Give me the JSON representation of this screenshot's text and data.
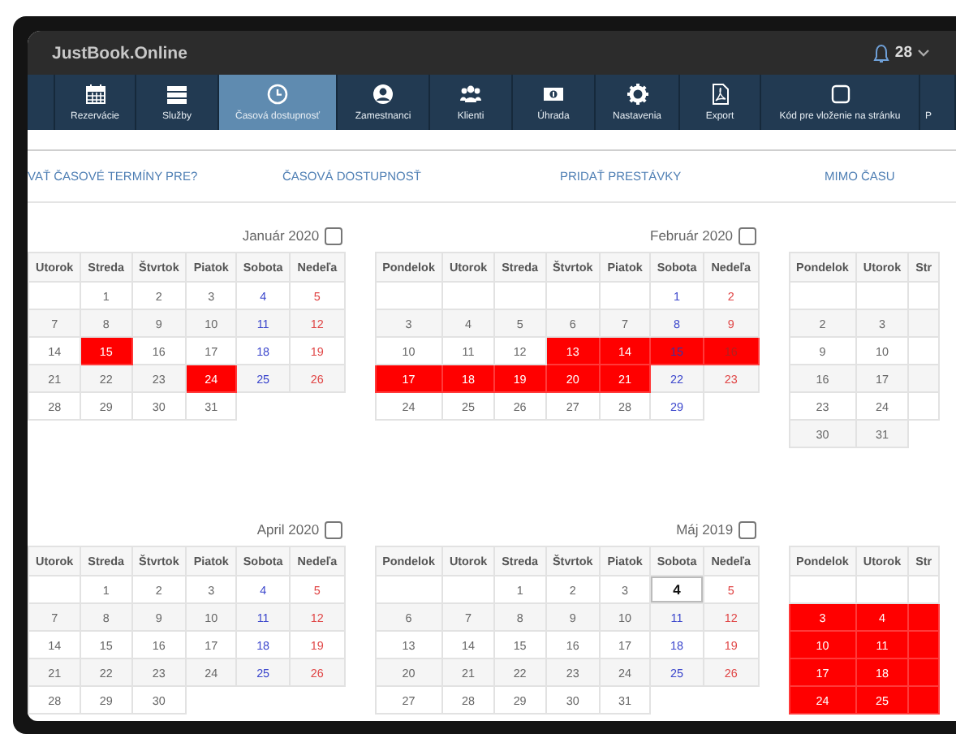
{
  "header": {
    "brand": "JustBook.Online",
    "notifications": "28"
  },
  "nav": [
    {
      "label": "Rezervácie",
      "selected": false
    },
    {
      "label": "Služby",
      "selected": false
    },
    {
      "label": "Časová dostupnosť",
      "selected": true
    },
    {
      "label": "Zamestnanci",
      "selected": false
    },
    {
      "label": "Klienti",
      "selected": false
    },
    {
      "label": "Úhrada",
      "selected": false
    },
    {
      "label": "Nastavenia",
      "selected": false
    },
    {
      "label": "Export",
      "selected": false
    },
    {
      "label": "Kód pre vloženie na stránku",
      "selected": false
    },
    {
      "label": "P",
      "selected": false
    }
  ],
  "subtabs": [
    "VAŤ ČASOVÉ TERMÍNY PRE?",
    "ČASOVÁ DOSTUPNOSŤ",
    "PRIDAŤ PRESTÁVKY",
    "MIMO ČASU"
  ],
  "calendar_rows": [
    {
      "calendars": [
        {
          "title": "Január 2020",
          "checked": false,
          "columns": [
            {
              "label": "Utorok",
              "kind": "weekday"
            },
            {
              "label": "Streda",
              "kind": "weekday"
            },
            {
              "label": "Štvrtok",
              "kind": "weekday"
            },
            {
              "label": "Piatok",
              "kind": "weekday"
            },
            {
              "label": "Sobota",
              "kind": "saturday"
            },
            {
              "label": "Nedeľa",
              "kind": "sunday"
            }
          ],
          "weeks": [
            [
              {
                "blocked": false,
                "today": false
              },
              {
                "day": "1",
                "blocked": false,
                "today": false
              },
              {
                "day": "2",
                "blocked": false,
                "today": false
              },
              {
                "day": "3",
                "blocked": false,
                "today": false
              },
              {
                "day": "4",
                "blocked": false,
                "today": false
              },
              {
                "day": "5",
                "blocked": false,
                "today": false
              }
            ],
            [
              {
                "day": "7",
                "blocked": false,
                "today": false
              },
              {
                "day": "8",
                "blocked": false,
                "today": false
              },
              {
                "day": "9",
                "blocked": false,
                "today": false
              },
              {
                "day": "10",
                "blocked": false,
                "today": false
              },
              {
                "day": "11",
                "blocked": false,
                "today": false
              },
              {
                "day": "12",
                "blocked": false,
                "today": false
              }
            ],
            [
              {
                "day": "14",
                "blocked": false,
                "today": false
              },
              {
                "day": "15",
                "blocked": true,
                "today": false
              },
              {
                "day": "16",
                "blocked": false,
                "today": false
              },
              {
                "day": "17",
                "blocked": false,
                "today": false
              },
              {
                "day": "18",
                "blocked": false,
                "today": false
              },
              {
                "day": "19",
                "blocked": false,
                "today": false
              }
            ],
            [
              {
                "day": "21",
                "blocked": false,
                "today": false
              },
              {
                "day": "22",
                "blocked": false,
                "today": false
              },
              {
                "day": "23",
                "blocked": false,
                "today": false
              },
              {
                "day": "24",
                "blocked": true,
                "today": false
              },
              {
                "day": "25",
                "blocked": false,
                "today": false
              },
              {
                "day": "26",
                "blocked": false,
                "today": false
              }
            ],
            [
              {
                "day": "28",
                "blocked": false,
                "today": false
              },
              {
                "day": "29",
                "blocked": false,
                "today": false
              },
              {
                "day": "30",
                "blocked": false,
                "today": false
              },
              {
                "day": "31",
                "blocked": false,
                "today": false
              }
            ]
          ]
        },
        {
          "title": "Február 2020",
          "checked": false,
          "columns": [
            {
              "label": "Pondelok",
              "kind": "weekday"
            },
            {
              "label": "Utorok",
              "kind": "weekday"
            },
            {
              "label": "Streda",
              "kind": "weekday"
            },
            {
              "label": "Štvrtok",
              "kind": "weekday"
            },
            {
              "label": "Piatok",
              "kind": "weekday"
            },
            {
              "label": "Sobota",
              "kind": "saturday"
            },
            {
              "label": "Nedeľa",
              "kind": "sunday"
            }
          ],
          "weeks": [
            [
              {
                "blocked": false,
                "today": false
              },
              {
                "blocked": false,
                "today": false
              },
              {
                "blocked": false,
                "today": false
              },
              {
                "blocked": false,
                "today": false
              },
              {
                "blocked": false,
                "today": false
              },
              {
                "day": "1",
                "blocked": false,
                "today": false
              },
              {
                "day": "2",
                "blocked": false,
                "today": false
              }
            ],
            [
              {
                "day": "3",
                "blocked": false,
                "today": false
              },
              {
                "day": "4",
                "blocked": false,
                "today": false
              },
              {
                "day": "5",
                "blocked": false,
                "today": false
              },
              {
                "day": "6",
                "blocked": false,
                "today": false
              },
              {
                "day": "7",
                "blocked": false,
                "today": false
              },
              {
                "day": "8",
                "blocked": false,
                "today": false
              },
              {
                "day": "9",
                "blocked": false,
                "today": false
              }
            ],
            [
              {
                "day": "10",
                "blocked": false,
                "today": false
              },
              {
                "day": "11",
                "blocked": false,
                "today": false
              },
              {
                "day": "12",
                "blocked": false,
                "today": false
              },
              {
                "day": "13",
                "blocked": true,
                "today": false
              },
              {
                "day": "14",
                "blocked": true,
                "today": false
              },
              {
                "day": "15",
                "blocked": true,
                "today": false
              },
              {
                "day": "16",
                "blocked": true,
                "today": false
              }
            ],
            [
              {
                "day": "17",
                "blocked": true,
                "today": false
              },
              {
                "day": "18",
                "blocked": true,
                "today": false
              },
              {
                "day": "19",
                "blocked": true,
                "today": false
              },
              {
                "day": "20",
                "blocked": true,
                "today": false
              },
              {
                "day": "21",
                "blocked": true,
                "today": false
              },
              {
                "day": "22",
                "blocked": false,
                "today": false
              },
              {
                "day": "23",
                "blocked": false,
                "today": false
              }
            ],
            [
              {
                "day": "24",
                "blocked": false,
                "today": false
              },
              {
                "day": "25",
                "blocked": false,
                "today": false
              },
              {
                "day": "26",
                "blocked": false,
                "today": false
              },
              {
                "day": "27",
                "blocked": false,
                "today": false
              },
              {
                "day": "28",
                "blocked": false,
                "today": false
              },
              {
                "day": "29",
                "blocked": false,
                "today": false
              }
            ]
          ]
        },
        {
          "columns": [
            {
              "label": "Pondelok",
              "kind": "weekday"
            },
            {
              "label": "Utorok",
              "kind": "weekday"
            },
            {
              "label": "Str",
              "kind": "weekday"
            }
          ],
          "weeks": [
            [
              {
                "blocked": false,
                "today": false
              },
              {
                "blocked": false,
                "today": false
              },
              {
                "blocked": false,
                "today": false
              }
            ],
            [
              {
                "day": "2",
                "blocked": false,
                "today": false
              },
              {
                "day": "3",
                "blocked": false,
                "today": false
              },
              {
                "blocked": false,
                "today": false
              }
            ],
            [
              {
                "day": "9",
                "blocked": false,
                "today": false
              },
              {
                "day": "10",
                "blocked": false,
                "today": false
              },
              {
                "blocked": false,
                "today": false
              }
            ],
            [
              {
                "day": "16",
                "blocked": false,
                "today": false
              },
              {
                "day": "17",
                "blocked": false,
                "today": false
              },
              {
                "blocked": false,
                "today": false
              }
            ],
            [
              {
                "day": "23",
                "blocked": false,
                "today": false
              },
              {
                "day": "24",
                "blocked": false,
                "today": false
              },
              {
                "blocked": false,
                "today": false
              }
            ],
            [
              {
                "day": "30",
                "blocked": false,
                "today": false
              },
              {
                "day": "31",
                "blocked": false,
                "today": false
              }
            ]
          ]
        }
      ]
    },
    {
      "calendars": [
        {
          "title": "April 2020",
          "checked": false,
          "columns": [
            {
              "label": "Utorok",
              "kind": "weekday"
            },
            {
              "label": "Streda",
              "kind": "weekday"
            },
            {
              "label": "Štvrtok",
              "kind": "weekday"
            },
            {
              "label": "Piatok",
              "kind": "weekday"
            },
            {
              "label": "Sobota",
              "kind": "saturday"
            },
            {
              "label": "Nedeľa",
              "kind": "sunday"
            }
          ],
          "weeks": [
            [
              {
                "blocked": false,
                "today": false
              },
              {
                "day": "1",
                "blocked": false,
                "today": false
              },
              {
                "day": "2",
                "blocked": false,
                "today": false
              },
              {
                "day": "3",
                "blocked": false,
                "today": false
              },
              {
                "day": "4",
                "blocked": false,
                "today": false
              },
              {
                "day": "5",
                "blocked": false,
                "today": false
              }
            ],
            [
              {
                "day": "7",
                "blocked": false,
                "today": false
              },
              {
                "day": "8",
                "blocked": false,
                "today": false
              },
              {
                "day": "9",
                "blocked": false,
                "today": false
              },
              {
                "day": "10",
                "blocked": false,
                "today": false
              },
              {
                "day": "11",
                "blocked": false,
                "today": false
              },
              {
                "day": "12",
                "blocked": false,
                "today": false
              }
            ],
            [
              {
                "day": "14",
                "blocked": false,
                "today": false
              },
              {
                "day": "15",
                "blocked": false,
                "today": false
              },
              {
                "day": "16",
                "blocked": false,
                "today": false
              },
              {
                "day": "17",
                "blocked": false,
                "today": false
              },
              {
                "day": "18",
                "blocked": false,
                "today": false
              },
              {
                "day": "19",
                "blocked": false,
                "today": false
              }
            ],
            [
              {
                "day": "21",
                "blocked": false,
                "today": false
              },
              {
                "day": "22",
                "blocked": false,
                "today": false
              },
              {
                "day": "23",
                "blocked": false,
                "today": false
              },
              {
                "day": "24",
                "blocked": false,
                "today": false
              },
              {
                "day": "25",
                "blocked": false,
                "today": false
              },
              {
                "day": "26",
                "blocked": false,
                "today": false
              }
            ],
            [
              {
                "day": "28",
                "blocked": false,
                "today": false
              },
              {
                "day": "29",
                "blocked": false,
                "today": false
              },
              {
                "day": "30",
                "blocked": false,
                "today": false
              }
            ]
          ]
        },
        {
          "title": "Máj 2019",
          "checked": false,
          "columns": [
            {
              "label": "Pondelok",
              "kind": "weekday"
            },
            {
              "label": "Utorok",
              "kind": "weekday"
            },
            {
              "label": "Streda",
              "kind": "weekday"
            },
            {
              "label": "Štvrtok",
              "kind": "weekday"
            },
            {
              "label": "Piatok",
              "kind": "weekday"
            },
            {
              "label": "Sobota",
              "kind": "saturday"
            },
            {
              "label": "Nedeľa",
              "kind": "sunday"
            }
          ],
          "weeks": [
            [
              {
                "blocked": false,
                "today": false
              },
              {
                "blocked": false,
                "today": false
              },
              {
                "day": "1",
                "blocked": false,
                "today": false
              },
              {
                "day": "2",
                "blocked": false,
                "today": false
              },
              {
                "day": "3",
                "blocked": false,
                "today": false
              },
              {
                "day": "4",
                "blocked": false,
                "today": true
              },
              {
                "day": "5",
                "blocked": false,
                "today": false
              }
            ],
            [
              {
                "day": "6",
                "blocked": false,
                "today": false
              },
              {
                "day": "7",
                "blocked": false,
                "today": false
              },
              {
                "day": "8",
                "blocked": false,
                "today": false
              },
              {
                "day": "9",
                "blocked": false,
                "today": false
              },
              {
                "day": "10",
                "blocked": false,
                "today": false
              },
              {
                "day": "11",
                "blocked": false,
                "today": false
              },
              {
                "day": "12",
                "blocked": false,
                "today": false
              }
            ],
            [
              {
                "day": "13",
                "blocked": false,
                "today": false
              },
              {
                "day": "14",
                "blocked": false,
                "today": false
              },
              {
                "day": "15",
                "blocked": false,
                "today": false
              },
              {
                "day": "16",
                "blocked": false,
                "today": false
              },
              {
                "day": "17",
                "blocked": false,
                "today": false
              },
              {
                "day": "18",
                "blocked": false,
                "today": false
              },
              {
                "day": "19",
                "blocked": false,
                "today": false
              }
            ],
            [
              {
                "day": "20",
                "blocked": false,
                "today": false
              },
              {
                "day": "21",
                "blocked": false,
                "today": false
              },
              {
                "day": "22",
                "blocked": false,
                "today": false
              },
              {
                "day": "23",
                "blocked": false,
                "today": false
              },
              {
                "day": "24",
                "blocked": false,
                "today": false
              },
              {
                "day": "25",
                "blocked": false,
                "today": false
              },
              {
                "day": "26",
                "blocked": false,
                "today": false
              }
            ],
            [
              {
                "day": "27",
                "blocked": false,
                "today": false
              },
              {
                "day": "28",
                "blocked": false,
                "today": false
              },
              {
                "day": "29",
                "blocked": false,
                "today": false
              },
              {
                "day": "30",
                "blocked": false,
                "today": false
              },
              {
                "day": "31",
                "blocked": false,
                "today": false
              }
            ]
          ]
        },
        {
          "columns": [
            {
              "label": "Pondelok",
              "kind": "weekday"
            },
            {
              "label": "Utorok",
              "kind": "weekday"
            },
            {
              "label": "Str",
              "kind": "weekday"
            }
          ],
          "weeks": [
            [
              {
                "blocked": false,
                "today": false
              },
              {
                "blocked": false,
                "today": false
              },
              {
                "blocked": false,
                "today": false
              }
            ],
            [
              {
                "day": "3",
                "blocked": true,
                "today": false
              },
              {
                "day": "4",
                "blocked": true,
                "today": false
              },
              {
                "blocked": true,
                "today": false
              }
            ],
            [
              {
                "day": "10",
                "blocked": true,
                "today": false
              },
              {
                "day": "11",
                "blocked": true,
                "today": false
              },
              {
                "blocked": true,
                "today": false
              }
            ],
            [
              {
                "day": "17",
                "blocked": true,
                "today": false
              },
              {
                "day": "18",
                "blocked": true,
                "today": false
              },
              {
                "blocked": true,
                "today": false
              }
            ],
            [
              {
                "day": "24",
                "blocked": true,
                "today": false
              },
              {
                "day": "25",
                "blocked": true,
                "today": false
              },
              {
                "blocked": true,
                "today": false
              }
            ]
          ]
        }
      ]
    }
  ]
}
